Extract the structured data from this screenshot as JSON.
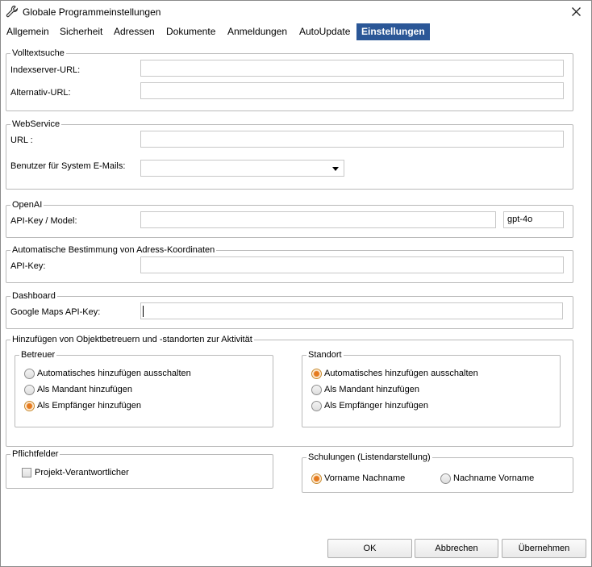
{
  "window": {
    "title": "Globale Programmeinstellungen",
    "icon": "wrench-icon"
  },
  "tabs": [
    {
      "label": "Allgemein"
    },
    {
      "label": "Sicherheit"
    },
    {
      "label": "Adressen"
    },
    {
      "label": "Dokumente"
    },
    {
      "label": "Anmeldungen"
    },
    {
      "label": "AutoUpdate"
    },
    {
      "label": "Einstellungen",
      "active": true
    }
  ],
  "volltextsuche": {
    "legend": "Volltextsuche",
    "indexserver_label": "Indexserver-URL:",
    "indexserver_value": "",
    "alternativ_label": "Alternativ-URL:",
    "alternativ_value": ""
  },
  "webservice": {
    "legend": "WebService",
    "url_label": "URL :",
    "url_value": "",
    "benutzer_label": "Benutzer für System E-Mails:",
    "benutzer_value": ""
  },
  "openai": {
    "legend": "OpenAI",
    "apikey_label": "API-Key / Model:",
    "apikey_value": "",
    "model_value": "gpt-4o"
  },
  "koordinaten": {
    "legend": "Automatische Bestimmung von Adress-Koordinaten",
    "apikey_label": "API-Key:",
    "apikey_value": ""
  },
  "dashboard": {
    "legend": "Dashboard",
    "maps_label": "Google Maps API-Key:",
    "maps_value": ""
  },
  "hinzufuegen": {
    "legend": "Hinzufügen von Objektbetreuern und -standorten zur Aktivität",
    "betreuer": {
      "legend": "Betreuer",
      "options": [
        "Automatisches hinzufügen ausschalten",
        "Als Mandant hinzufügen",
        "Als Empfänger hinzufügen"
      ],
      "selected": 2
    },
    "standort": {
      "legend": "Standort",
      "options": [
        "Automatisches hinzufügen ausschalten",
        "Als Mandant hinzufügen",
        "Als Empfänger hinzufügen"
      ],
      "selected": 0
    }
  },
  "pflichtfelder": {
    "legend": "Pflichtfelder",
    "projekt_label": "Projekt-Verantwortlicher",
    "projekt_checked": false
  },
  "schulungen": {
    "legend": "Schulungen (Listendarstellung)",
    "options": [
      "Vorname Nachname",
      "Nachname Vorname"
    ],
    "selected": 0
  },
  "buttons": {
    "ok": "OK",
    "abbrechen": "Abbrechen",
    "uebernehmen": "Übernehmen"
  },
  "colors": {
    "active_tab": "#2b5797",
    "radio_selected": "#e57a1e",
    "border": "#b9b9b9"
  }
}
